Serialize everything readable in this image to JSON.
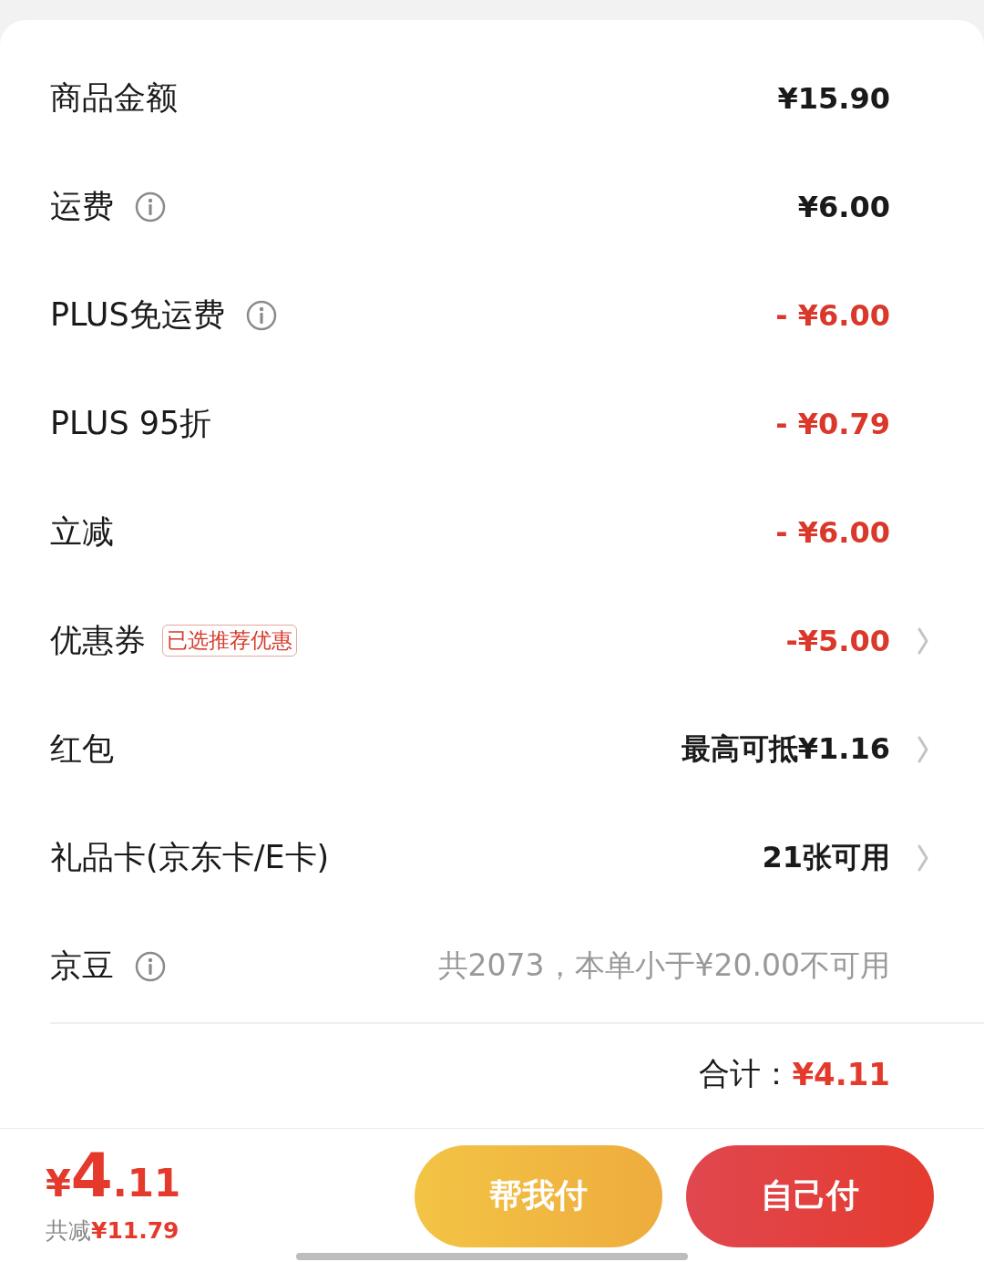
{
  "rows": [
    {
      "label": "商品金额",
      "info": false,
      "value": "¥15.90",
      "kind": "plain",
      "arrow": false
    },
    {
      "label": "运费",
      "info": true,
      "value": "¥6.00",
      "kind": "plain",
      "arrow": false
    },
    {
      "label": "PLUS免运费",
      "info": true,
      "value": "- ¥6.00",
      "kind": "discount",
      "arrow": false
    },
    {
      "label": "PLUS 95折",
      "info": false,
      "value": "- ¥0.79",
      "kind": "discount",
      "arrow": false
    },
    {
      "label": "立减",
      "info": false,
      "value": "- ¥6.00",
      "kind": "discount",
      "arrow": false
    },
    {
      "label": "优惠券",
      "info": false,
      "badge": "已选推荐优惠",
      "value": "-¥5.00",
      "kind": "discount",
      "arrow": true
    },
    {
      "label": "红包",
      "info": false,
      "value": "最高可抵¥1.16",
      "kind": "plain",
      "arrow": true
    },
    {
      "label": "礼品卡(京东卡/E卡)",
      "info": false,
      "value": "21张可用",
      "kind": "plain",
      "arrow": true
    },
    {
      "label": "京豆",
      "info": true,
      "value": "共2073，本单小于¥20.00不可用",
      "kind": "muted",
      "arrow": false
    }
  ],
  "total": {
    "label": "合计：",
    "value": "¥4.11"
  },
  "footer": {
    "price": "¥4.11",
    "saved_label": "共减",
    "saved_value": "¥11.79",
    "buttons": [
      {
        "label": "帮我付",
        "kind": "secondary"
      },
      {
        "label": "自己付",
        "kind": "primary"
      }
    ]
  }
}
